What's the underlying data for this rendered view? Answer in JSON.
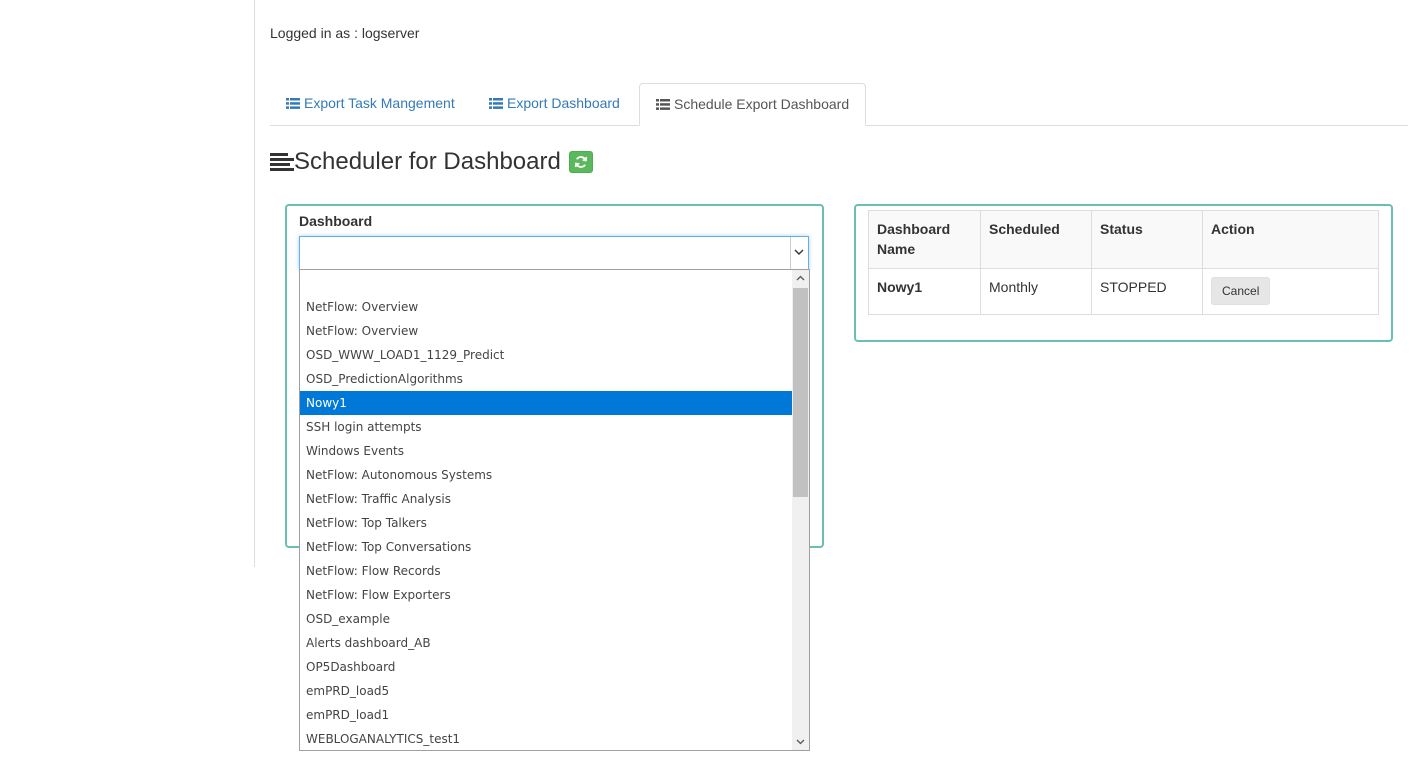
{
  "header": {
    "logged_in": "Logged in as : logserver"
  },
  "tabs": [
    {
      "label": "Export Task Mangement",
      "active": false
    },
    {
      "label": "Export Dashboard",
      "active": false
    },
    {
      "label": "Schedule Export Dashboard",
      "active": true
    }
  ],
  "page": {
    "title": "Scheduler for Dashboard",
    "title_icon": "align-left-icon",
    "refresh_icon": "refresh-icon"
  },
  "form": {
    "dashboard_label": "Dashboard",
    "selected_value": ""
  },
  "dropdown": {
    "options": [
      "",
      "NetFlow: Overview",
      "NetFlow: Overview",
      "OSD_WWW_LOAD1_1129_Predict",
      "OSD_PredictionAlgorithms",
      "Nowy1",
      "SSH login attempts",
      "Windows Events",
      "NetFlow: Autonomous Systems",
      "NetFlow: Traffic Analysis",
      "NetFlow: Top Talkers",
      "NetFlow: Top Conversations",
      "NetFlow: Flow Records",
      "NetFlow: Flow Exporters",
      "OSD_example",
      "Alerts dashboard_AB",
      "OP5Dashboard",
      "emPRD_load5",
      "emPRD_load1",
      "WEBLOGANALYTICS_test1"
    ],
    "highlighted": "Nowy1"
  },
  "schedule_table": {
    "headers": [
      "Dashboard Name",
      "Scheduled",
      "Status",
      "Action"
    ],
    "rows": [
      {
        "name": "Nowy1",
        "scheduled": "Monthly",
        "status": "STOPPED",
        "action": "Cancel"
      }
    ]
  },
  "colors": {
    "link": "#337ab7",
    "panel_border": "#6abfb3",
    "refresh_green": "#5cb85c",
    "selection": "#0078d7"
  }
}
